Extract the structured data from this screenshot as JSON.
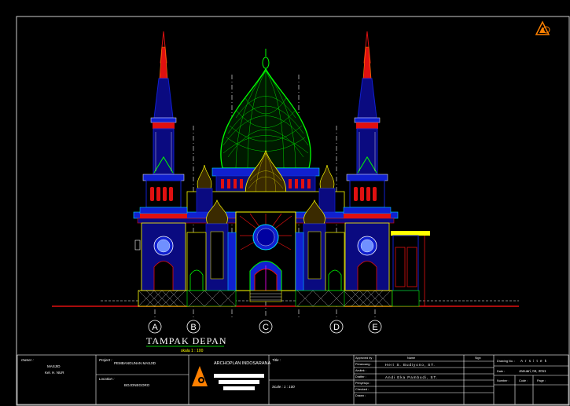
{
  "drawing": {
    "title": "TAMPAK DEPAN",
    "scale": "skala 1 : 100",
    "axis_labels": [
      "A",
      "B",
      "C",
      "D",
      "E"
    ]
  },
  "colors": {
    "background": "#000000",
    "blue": "#1020d0",
    "navy": "#0a0a80",
    "red": "#e01010",
    "green": "#00ff00",
    "yellow": "#ffff00",
    "white": "#ffffff",
    "cyan": "#00e0ff",
    "magenta": "#ff00ff",
    "orange": "#ff8000"
  },
  "title_block": {
    "owner_label": "Owner :",
    "owner_value_1": "MASJID",
    "owner_value_2": "Kel. H. NUR",
    "project_label": "Project :",
    "project_value": "PEMBANGUNAN MASJID",
    "location_label": "Location :",
    "location_value": "BOJONEGORO",
    "firm_name": "ARCHOPLAN INDOSARANA",
    "title_label": "Title :",
    "scale_label": "Scale : 1 : 100",
    "approved_label": "Approved by :",
    "name_label": "Name",
    "sign_label": "Sign",
    "designer_label": "Perancang :",
    "designer_name": "Heri S. Budiyono, ST.",
    "architect_label": "Arsitek :",
    "drafter_label": "Drafter :",
    "drafter_name": "Andi Eka Pambudi, ST.",
    "approver_label": "Penyetuju :",
    "checked_label": "Checked :",
    "drawn_label": "Drawn :",
    "date_label": "Date :",
    "date_value": "Januari, 04, 2011",
    "drawing_no_label": "Drawing No. :",
    "drawing_no_value": "A r s i t e k",
    "number_label": "Number :",
    "code_label": "Code :",
    "page_label": "Page :"
  }
}
